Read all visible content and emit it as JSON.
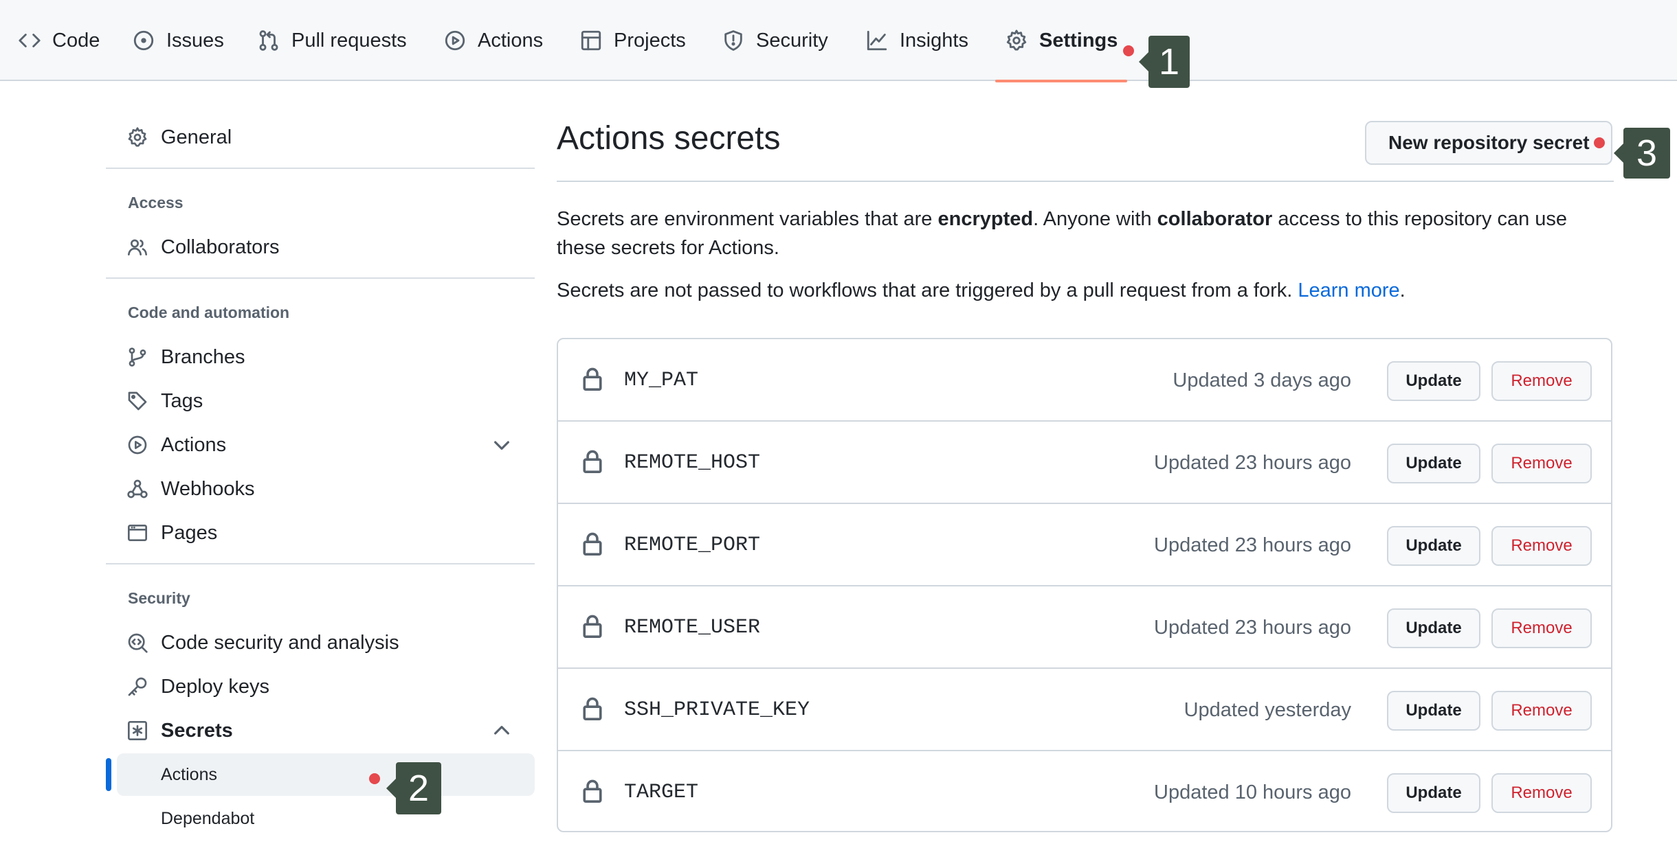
{
  "topnav": {
    "tabs": [
      {
        "label": "Code",
        "icon": "code-icon"
      },
      {
        "label": "Issues",
        "icon": "issue-icon"
      },
      {
        "label": "Pull requests",
        "icon": "pull-request-icon"
      },
      {
        "label": "Actions",
        "icon": "play-icon"
      },
      {
        "label": "Projects",
        "icon": "table-icon"
      },
      {
        "label": "Security",
        "icon": "shield-icon"
      },
      {
        "label": "Insights",
        "icon": "graph-icon"
      },
      {
        "label": "Settings",
        "icon": "gear-icon",
        "active": true
      }
    ]
  },
  "callouts": {
    "one": "1",
    "two": "2",
    "three": "3"
  },
  "sidebar": {
    "general": "General",
    "access_heading": "Access",
    "collaborators": "Collaborators",
    "code_automation_heading": "Code and automation",
    "branches": "Branches",
    "tags": "Tags",
    "actions": "Actions",
    "webhooks": "Webhooks",
    "pages": "Pages",
    "security_heading": "Security",
    "code_security": "Code security and analysis",
    "deploy_keys": "Deploy keys",
    "secrets": "Secrets",
    "secrets_sub": [
      {
        "label": "Actions",
        "active": true
      },
      {
        "label": "Dependabot"
      }
    ]
  },
  "main": {
    "title": "Actions secrets",
    "new_secret_label": "New repository secret",
    "desc1": {
      "part1": "Secrets are environment variables that are ",
      "bold1": "encrypted",
      "part2": ". Anyone with ",
      "bold2": "collaborator",
      "part3": " access to this repository can use these secrets for Actions."
    },
    "desc2": {
      "text": "Secrets are not passed to workflows that are triggered by a pull request from a fork. ",
      "link": "Learn more",
      "end": "."
    },
    "update_label": "Update",
    "remove_label": "Remove",
    "secrets": [
      {
        "name": "MY_PAT",
        "updated": "Updated 3 days ago"
      },
      {
        "name": "REMOTE_HOST",
        "updated": "Updated 23 hours ago"
      },
      {
        "name": "REMOTE_PORT",
        "updated": "Updated 23 hours ago"
      },
      {
        "name": "REMOTE_USER",
        "updated": "Updated 23 hours ago"
      },
      {
        "name": "SSH_PRIVATE_KEY",
        "updated": "Updated yesterday"
      },
      {
        "name": "TARGET",
        "updated": "Updated 10 hours ago"
      }
    ]
  },
  "colors": {
    "accent": "#0969da",
    "danger": "#cf222e",
    "active_underline": "#fd8c73",
    "marker": "#e5484d",
    "callout_bg": "#3f5144"
  }
}
